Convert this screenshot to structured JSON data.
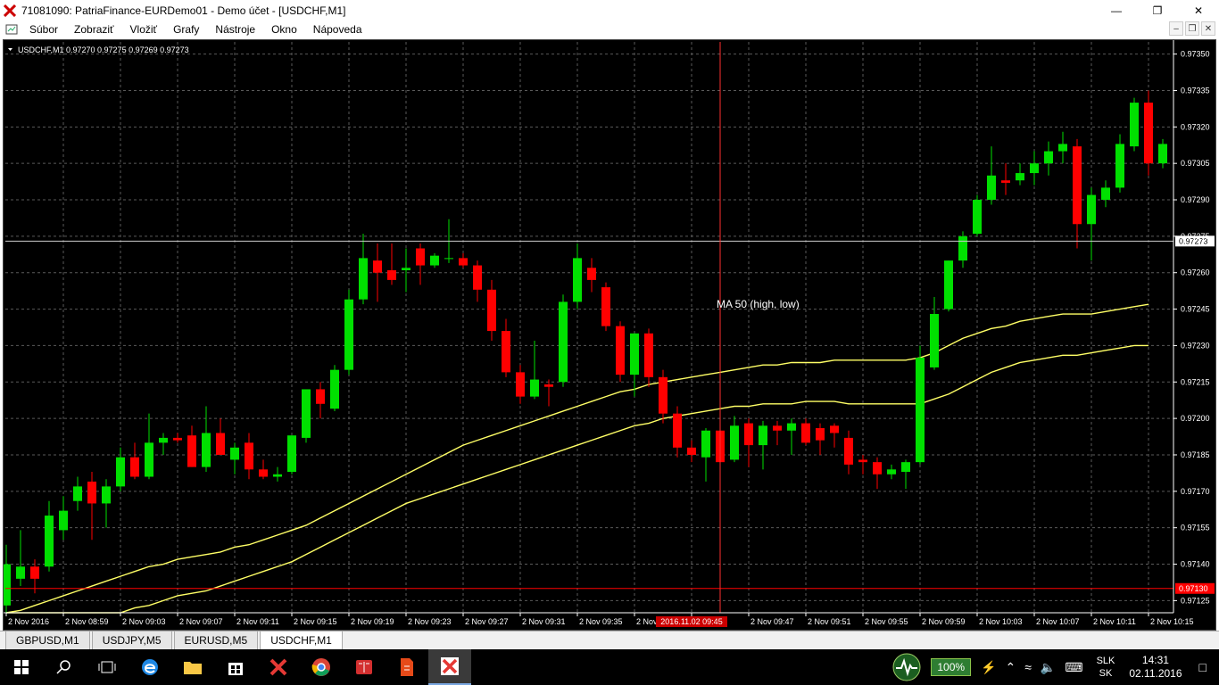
{
  "window": {
    "title": "71081090: PatriaFinance-EURDemo01 - Demo účet - [USDCHF,M1]"
  },
  "menu": [
    "Súbor",
    "Zobraziť",
    "Vložiť",
    "Grafy",
    "Nástroje",
    "Okno",
    "Nápoveda"
  ],
  "chart_header": "USDCHF,M1  0.97270 0.97275 0.97269 0.97273",
  "indicator_label": "MA 50 (high, low)",
  "price_ticks": [
    "0.97350",
    "0.97335",
    "0.97320",
    "0.97305",
    "0.97290",
    "0.97275",
    "0.97260",
    "0.97245",
    "0.97230",
    "0.97215",
    "0.97200",
    "0.97185",
    "0.97170",
    "0.97155",
    "0.97140",
    "0.97125"
  ],
  "current_price_label": "0.97273",
  "hline_price_label": "0.97130",
  "time_ticks": [
    "2 Nov 2016",
    "2 Nov 08:59",
    "2 Nov 09:03",
    "2 Nov 09:07",
    "2 Nov 09:11",
    "2 Nov 09:15",
    "2 Nov 09:19",
    "2 Nov 09:23",
    "2 Nov 09:27",
    "2 Nov 09:31",
    "2 Nov 09:35",
    "2 Nov 09:39",
    "2016.11.02 09:45",
    "2 Nov 09:47",
    "2 Nov 09:51",
    "2 Nov 09:55",
    "2 Nov 09:59",
    "2 Nov 10:03",
    "2 Nov 10:07",
    "2 Nov 10:11",
    "2 Nov 10:15"
  ],
  "tabs": [
    {
      "label": "GBPUSD,M1",
      "active": false
    },
    {
      "label": "USDJPY,M5",
      "active": false
    },
    {
      "label": "EURUSD,M5",
      "active": false
    },
    {
      "label": "USDCHF,M1",
      "active": true
    }
  ],
  "tray": {
    "battery": "100%",
    "lang_top": "SLK",
    "lang_bottom": "SK",
    "time": "14:31",
    "date": "02.11.2016"
  },
  "colors": {
    "bull": "#00e000",
    "bear": "#ff0000",
    "ma": "#ffff66",
    "grid": "#5a5a5a",
    "hline": "#ff0000"
  },
  "chart_data": {
    "type": "candlestick",
    "title": "USDCHF,M1",
    "ylim": [
      0.9712,
      0.97355
    ],
    "candles": [
      {
        "o": 0.97123,
        "h": 0.97148,
        "l": 0.9712,
        "c": 0.9714
      },
      {
        "o": 0.97134,
        "h": 0.97154,
        "l": 0.97131,
        "c": 0.97139
      },
      {
        "o": 0.97139,
        "h": 0.97142,
        "l": 0.97128,
        "c": 0.97134
      },
      {
        "o": 0.97139,
        "h": 0.97166,
        "l": 0.97137,
        "c": 0.9716
      },
      {
        "o": 0.97154,
        "h": 0.97168,
        "l": 0.9715,
        "c": 0.97162
      },
      {
        "o": 0.97166,
        "h": 0.97176,
        "l": 0.97162,
        "c": 0.97172
      },
      {
        "o": 0.97174,
        "h": 0.97178,
        "l": 0.9715,
        "c": 0.97165
      },
      {
        "o": 0.97165,
        "h": 0.97175,
        "l": 0.97155,
        "c": 0.97172
      },
      {
        "o": 0.97172,
        "h": 0.97188,
        "l": 0.9717,
        "c": 0.97184
      },
      {
        "o": 0.97184,
        "h": 0.9719,
        "l": 0.97175,
        "c": 0.97176
      },
      {
        "o": 0.97176,
        "h": 0.97202,
        "l": 0.97175,
        "c": 0.9719
      },
      {
        "o": 0.9719,
        "h": 0.97194,
        "l": 0.97185,
        "c": 0.97192
      },
      {
        "o": 0.97192,
        "h": 0.97194,
        "l": 0.9719,
        "c": 0.97191
      },
      {
        "o": 0.97193,
        "h": 0.97197,
        "l": 0.9718,
        "c": 0.9718
      },
      {
        "o": 0.9718,
        "h": 0.97205,
        "l": 0.97178,
        "c": 0.97194
      },
      {
        "o": 0.97194,
        "h": 0.972,
        "l": 0.97185,
        "c": 0.97185
      },
      {
        "o": 0.97183,
        "h": 0.9719,
        "l": 0.97177,
        "c": 0.97188
      },
      {
        "o": 0.9719,
        "h": 0.97194,
        "l": 0.97175,
        "c": 0.97179
      },
      {
        "o": 0.97179,
        "h": 0.97183,
        "l": 0.97175,
        "c": 0.97176
      },
      {
        "o": 0.97176,
        "h": 0.9718,
        "l": 0.97174,
        "c": 0.97177
      },
      {
        "o": 0.97178,
        "h": 0.97193,
        "l": 0.97177,
        "c": 0.97193
      },
      {
        "o": 0.97192,
        "h": 0.97212,
        "l": 0.9719,
        "c": 0.97212
      },
      {
        "o": 0.97212,
        "h": 0.97215,
        "l": 0.972,
        "c": 0.97206
      },
      {
        "o": 0.97204,
        "h": 0.97222,
        "l": 0.97203,
        "c": 0.9722
      },
      {
        "o": 0.9722,
        "h": 0.97253,
        "l": 0.97218,
        "c": 0.97249
      },
      {
        "o": 0.97249,
        "h": 0.97276,
        "l": 0.97247,
        "c": 0.97266
      },
      {
        "o": 0.97265,
        "h": 0.97272,
        "l": 0.97248,
        "c": 0.9726
      },
      {
        "o": 0.97261,
        "h": 0.97272,
        "l": 0.97255,
        "c": 0.97257
      },
      {
        "o": 0.97261,
        "h": 0.9727,
        "l": 0.97252,
        "c": 0.97262
      },
      {
        "o": 0.9727,
        "h": 0.97272,
        "l": 0.97255,
        "c": 0.97263
      },
      {
        "o": 0.97263,
        "h": 0.97268,
        "l": 0.97262,
        "c": 0.97267
      },
      {
        "o": 0.97266,
        "h": 0.97282,
        "l": 0.97264,
        "c": 0.97266
      },
      {
        "o": 0.97266,
        "h": 0.97268,
        "l": 0.97262,
        "c": 0.97263
      },
      {
        "o": 0.97263,
        "h": 0.97265,
        "l": 0.97248,
        "c": 0.97253
      },
      {
        "o": 0.97253,
        "h": 0.97257,
        "l": 0.97232,
        "c": 0.97236
      },
      {
        "o": 0.97236,
        "h": 0.97241,
        "l": 0.97217,
        "c": 0.97219
      },
      {
        "o": 0.97219,
        "h": 0.97222,
        "l": 0.97206,
        "c": 0.97209
      },
      {
        "o": 0.97209,
        "h": 0.97232,
        "l": 0.97208,
        "c": 0.97216
      },
      {
        "o": 0.97214,
        "h": 0.97216,
        "l": 0.97205,
        "c": 0.97213
      },
      {
        "o": 0.97215,
        "h": 0.97251,
        "l": 0.97213,
        "c": 0.97248
      },
      {
        "o": 0.97248,
        "h": 0.97272,
        "l": 0.97245,
        "c": 0.97266
      },
      {
        "o": 0.97262,
        "h": 0.97266,
        "l": 0.97252,
        "c": 0.97257
      },
      {
        "o": 0.97254,
        "h": 0.97256,
        "l": 0.97236,
        "c": 0.97238
      },
      {
        "o": 0.97238,
        "h": 0.9724,
        "l": 0.97215,
        "c": 0.97218
      },
      {
        "o": 0.97218,
        "h": 0.97235,
        "l": 0.97209,
        "c": 0.97235
      },
      {
        "o": 0.97235,
        "h": 0.97237,
        "l": 0.97213,
        "c": 0.97217
      },
      {
        "o": 0.97217,
        "h": 0.9722,
        "l": 0.97198,
        "c": 0.97202
      },
      {
        "o": 0.97202,
        "h": 0.97205,
        "l": 0.97184,
        "c": 0.97188
      },
      {
        "o": 0.97188,
        "h": 0.97191,
        "l": 0.97182,
        "c": 0.97185
      },
      {
        "o": 0.97184,
        "h": 0.97196,
        "l": 0.97174,
        "c": 0.97195
      },
      {
        "o": 0.97195,
        "h": 0.972,
        "l": 0.9718,
        "c": 0.97182
      },
      {
        "o": 0.97183,
        "h": 0.97201,
        "l": 0.97182,
        "c": 0.97197
      },
      {
        "o": 0.97198,
        "h": 0.972,
        "l": 0.9718,
        "c": 0.97189
      },
      {
        "o": 0.97189,
        "h": 0.97199,
        "l": 0.97179,
        "c": 0.97197
      },
      {
        "o": 0.97197,
        "h": 0.97199,
        "l": 0.97189,
        "c": 0.97195
      },
      {
        "o": 0.97195,
        "h": 0.972,
        "l": 0.97185,
        "c": 0.97198
      },
      {
        "o": 0.97198,
        "h": 0.972,
        "l": 0.97189,
        "c": 0.9719
      },
      {
        "o": 0.97196,
        "h": 0.97198,
        "l": 0.97185,
        "c": 0.97191
      },
      {
        "o": 0.97197,
        "h": 0.97198,
        "l": 0.97188,
        "c": 0.97194
      },
      {
        "o": 0.97192,
        "h": 0.97195,
        "l": 0.97177,
        "c": 0.97181
      },
      {
        "o": 0.97183,
        "h": 0.97185,
        "l": 0.97177,
        "c": 0.97182
      },
      {
        "o": 0.97182,
        "h": 0.97184,
        "l": 0.97171,
        "c": 0.97177
      },
      {
        "o": 0.97177,
        "h": 0.97181,
        "l": 0.97175,
        "c": 0.97179
      },
      {
        "o": 0.97178,
        "h": 0.97183,
        "l": 0.97171,
        "c": 0.97182
      },
      {
        "o": 0.97182,
        "h": 0.9723,
        "l": 0.97181,
        "c": 0.97225
      },
      {
        "o": 0.97221,
        "h": 0.9725,
        "l": 0.9722,
        "c": 0.97243
      },
      {
        "o": 0.97245,
        "h": 0.97265,
        "l": 0.97244,
        "c": 0.97265
      },
      {
        "o": 0.97265,
        "h": 0.97277,
        "l": 0.97262,
        "c": 0.97275
      },
      {
        "o": 0.97276,
        "h": 0.97292,
        "l": 0.97275,
        "c": 0.9729
      },
      {
        "o": 0.9729,
        "h": 0.97312,
        "l": 0.97288,
        "c": 0.973
      },
      {
        "o": 0.97298,
        "h": 0.97305,
        "l": 0.97292,
        "c": 0.97297
      },
      {
        "o": 0.97298,
        "h": 0.97305,
        "l": 0.97296,
        "c": 0.97301
      },
      {
        "o": 0.97301,
        "h": 0.9731,
        "l": 0.97296,
        "c": 0.97305
      },
      {
        "o": 0.97305,
        "h": 0.97314,
        "l": 0.973,
        "c": 0.9731
      },
      {
        "o": 0.9731,
        "h": 0.97318,
        "l": 0.97305,
        "c": 0.97313
      },
      {
        "o": 0.97312,
        "h": 0.97315,
        "l": 0.9727,
        "c": 0.9728
      },
      {
        "o": 0.9728,
        "h": 0.97295,
        "l": 0.97265,
        "c": 0.97292
      },
      {
        "o": 0.9729,
        "h": 0.97298,
        "l": 0.97287,
        "c": 0.97295
      },
      {
        "o": 0.97295,
        "h": 0.97317,
        "l": 0.97293,
        "c": 0.97313
      },
      {
        "o": 0.97312,
        "h": 0.97332,
        "l": 0.9731,
        "c": 0.9733
      },
      {
        "o": 0.9733,
        "h": 0.97335,
        "l": 0.973,
        "c": 0.97305
      },
      {
        "o": 0.97305,
        "h": 0.97315,
        "l": 0.97303,
        "c": 0.97313
      }
    ],
    "ma_high": [
      0.9712,
      0.97121,
      0.97123,
      0.97125,
      0.97127,
      0.97129,
      0.97131,
      0.97133,
      0.97135,
      0.97137,
      0.97139,
      0.9714,
      0.97142,
      0.97143,
      0.97144,
      0.97145,
      0.97147,
      0.97148,
      0.9715,
      0.97152,
      0.97154,
      0.97156,
      0.97159,
      0.97162,
      0.97165,
      0.97168,
      0.97171,
      0.97174,
      0.97177,
      0.9718,
      0.97183,
      0.97186,
      0.97189,
      0.97191,
      0.97193,
      0.97195,
      0.97197,
      0.97199,
      0.97201,
      0.97203,
      0.97205,
      0.97207,
      0.97209,
      0.97211,
      0.97212,
      0.97214,
      0.97215,
      0.97216,
      0.97217,
      0.97218,
      0.97219,
      0.9722,
      0.97221,
      0.97222,
      0.97222,
      0.97223,
      0.97223,
      0.97223,
      0.97224,
      0.97224,
      0.97224,
      0.97224,
      0.97224,
      0.97224,
      0.97225,
      0.97227,
      0.9723,
      0.97233,
      0.97235,
      0.97237,
      0.97238,
      0.9724,
      0.97241,
      0.97242,
      0.97243,
      0.97243,
      0.97243,
      0.97244,
      0.97245,
      0.97246,
      0.97247
    ],
    "ma_low": [
      0.97105,
      0.97107,
      0.97109,
      0.97111,
      0.97113,
      0.97114,
      0.97116,
      0.97118,
      0.9712,
      0.97122,
      0.97123,
      0.97125,
      0.97127,
      0.97128,
      0.97129,
      0.97131,
      0.97133,
      0.97135,
      0.97137,
      0.97139,
      0.97141,
      0.97144,
      0.97147,
      0.9715,
      0.97153,
      0.97156,
      0.97159,
      0.97162,
      0.97165,
      0.97167,
      0.97169,
      0.97171,
      0.97173,
      0.97175,
      0.97177,
      0.97179,
      0.97181,
      0.97183,
      0.97185,
      0.97187,
      0.97189,
      0.97191,
      0.97193,
      0.97195,
      0.97197,
      0.97198,
      0.972,
      0.97201,
      0.97202,
      0.97203,
      0.97204,
      0.97205,
      0.97205,
      0.97206,
      0.97206,
      0.97206,
      0.97207,
      0.97207,
      0.97207,
      0.97206,
      0.97206,
      0.97206,
      0.97206,
      0.97206,
      0.97206,
      0.97208,
      0.9721,
      0.97213,
      0.97216,
      0.97219,
      0.97221,
      0.97223,
      0.97224,
      0.97225,
      0.97226,
      0.97226,
      0.97227,
      0.97228,
      0.97229,
      0.9723,
      0.9723
    ],
    "hline": 0.9713,
    "current_price": 0.97273,
    "crosshair_index": 50
  }
}
